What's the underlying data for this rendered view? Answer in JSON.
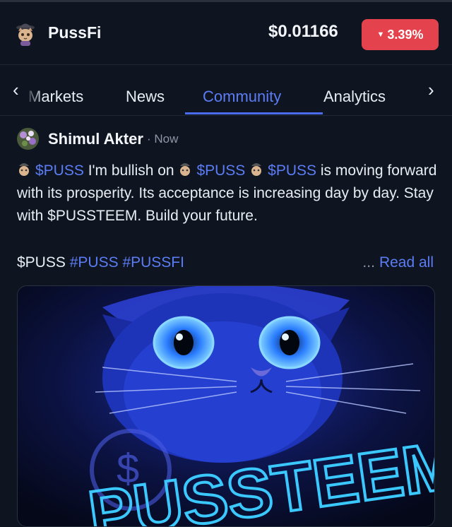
{
  "header": {
    "token_name": "PussFi",
    "price": "$0.01166",
    "change": "3.39%",
    "change_color": "#e4424d"
  },
  "tabs": {
    "items": [
      "Markets",
      "News",
      "Community",
      "Analytics"
    ],
    "active": "Community",
    "accent": "#5b7cf5"
  },
  "post": {
    "author": "Shimul Akter",
    "time": "· Now",
    "segments": {
      "t1": "$PUSS",
      "t2": " I'm bullish on ",
      "t3": "$PUSS",
      "t4": "$PUSS",
      "t5": " is moving forward with its prosperity. Its acceptance is increasing day by day. Stay with $PUSSTEEM. Build your future."
    },
    "tags": {
      "plain": "$PUSS",
      "hash1": "#PUSS",
      "hash2": "#PUSSFI"
    },
    "read_more_dots": "...",
    "read_all": "Read all",
    "image_text": "PUSSTEEM"
  },
  "icons": {
    "chevron_left": "chevron-left-icon",
    "chevron_right": "chevron-right-icon",
    "token": "cat-avatar-icon"
  }
}
